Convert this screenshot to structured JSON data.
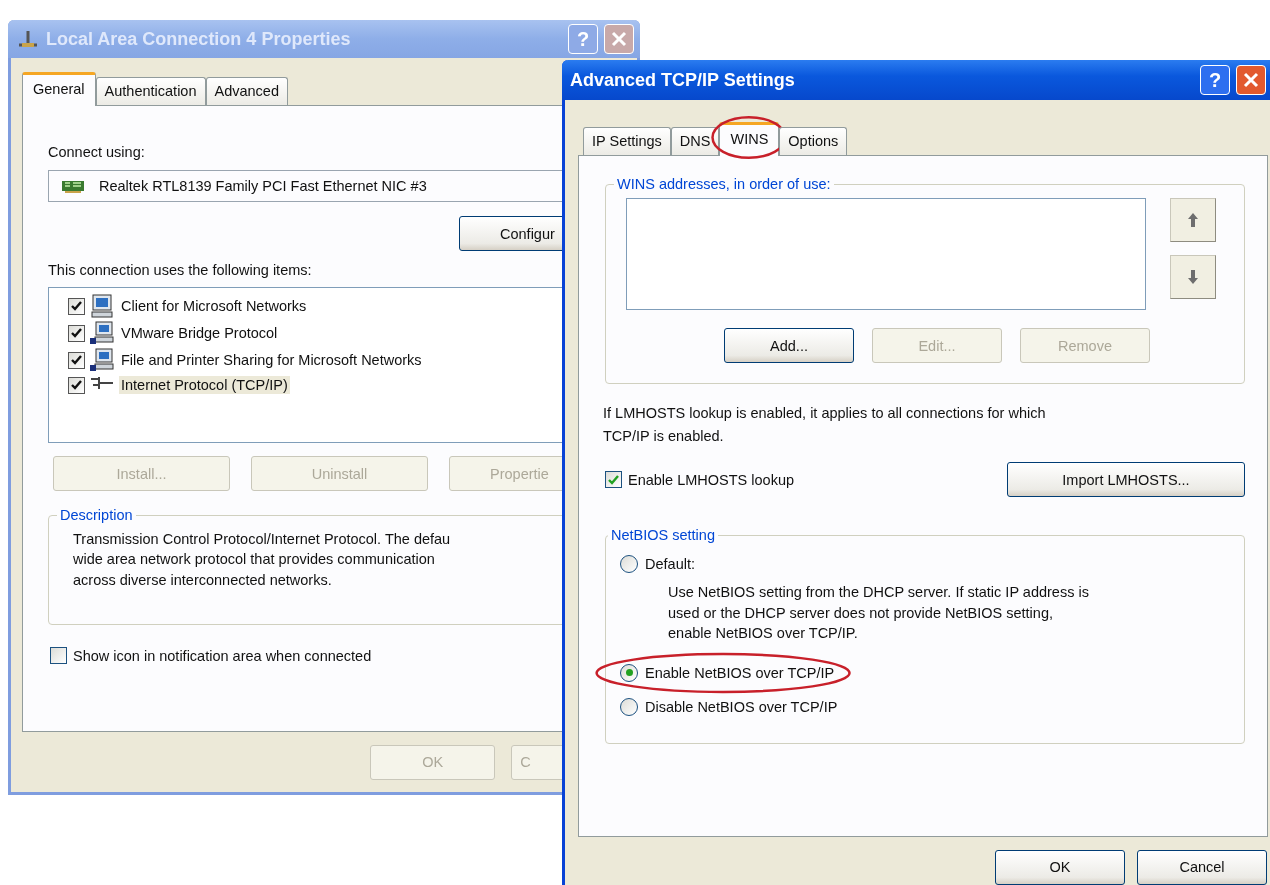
{
  "properties_window": {
    "title": "Local Area Connection 4 Properties",
    "active": false,
    "help_button": "?",
    "tabs": [
      {
        "label": "General",
        "selected": true
      },
      {
        "label": "Authentication",
        "selected": false
      },
      {
        "label": "Advanced",
        "selected": false
      }
    ],
    "connect_label": "Connect using:",
    "adapter": "Realtek RTL8139 Family PCI Fast Ethernet NIC #3",
    "configure_button": {
      "label": "Configur",
      "disabled": false
    },
    "items_label": "This connection uses the following items:",
    "items": [
      {
        "label": "Client for Microsoft Networks",
        "kind": "client",
        "checked": true,
        "selected": false
      },
      {
        "label": "VMware Bridge Protocol",
        "kind": "service",
        "checked": true,
        "selected": false
      },
      {
        "label": "File and Printer Sharing for Microsoft Networks",
        "kind": "service",
        "checked": true,
        "selected": false
      },
      {
        "label": "Internet Protocol (TCP/IP)",
        "kind": "protocol",
        "checked": true,
        "selected": true
      }
    ],
    "item_buttons": [
      {
        "label": "Install...",
        "disabled": true
      },
      {
        "label": "Uninstall",
        "disabled": true
      },
      {
        "label": "Propertie",
        "disabled": true
      }
    ],
    "description": {
      "title": "Description",
      "text": "Transmission Control Protocol/Internet Protocol. The defau\nwide area network protocol that provides communication\nacross diverse interconnected networks."
    },
    "notify_checkbox": {
      "label": "Show icon in notification area when connected",
      "checked": false
    },
    "footer_buttons": [
      {
        "label": "OK",
        "disabled": true
      },
      {
        "label": "C",
        "disabled": true
      }
    ]
  },
  "advanced_window": {
    "title": "Advanced TCP/IP Settings",
    "active": true,
    "help_button": "?",
    "tabs": [
      {
        "label": "IP Settings",
        "selected": false,
        "circled": false
      },
      {
        "label": "DNS",
        "selected": false,
        "circled": false
      },
      {
        "label": "WINS",
        "selected": true,
        "circled": true
      },
      {
        "label": "Options",
        "selected": false,
        "circled": false
      }
    ],
    "wins_group": {
      "title": "WINS addresses, in order of use:",
      "buttons": [
        {
          "label": "Add...",
          "disabled": false
        },
        {
          "label": "Edit...",
          "disabled": true
        },
        {
          "label": "Remove",
          "disabled": true
        }
      ]
    },
    "lmhosts_note": "If LMHOSTS lookup is enabled, it applies to all connections for which\nTCP/IP is enabled.",
    "lmhosts_checkbox": {
      "label": "Enable LMHOSTS lookup",
      "checked": true
    },
    "import_button": {
      "label": "Import LMHOSTS...",
      "disabled": false
    },
    "netbios_group": {
      "title": "NetBIOS setting",
      "options": [
        {
          "label": "Default:",
          "selected": false,
          "circled": false,
          "description": "Use NetBIOS setting from the DHCP server. If static IP address is\nused or the DHCP server does not provide NetBIOS setting,\nenable NetBIOS over TCP/IP."
        },
        {
          "label": "Enable NetBIOS over TCP/IP",
          "selected": true,
          "circled": true
        },
        {
          "label": "Disable NetBIOS over TCP/IP",
          "selected": false,
          "circled": false
        }
      ]
    },
    "footer_buttons": [
      {
        "label": "OK",
        "disabled": false
      },
      {
        "label": "Cancel",
        "disabled": false
      }
    ]
  }
}
